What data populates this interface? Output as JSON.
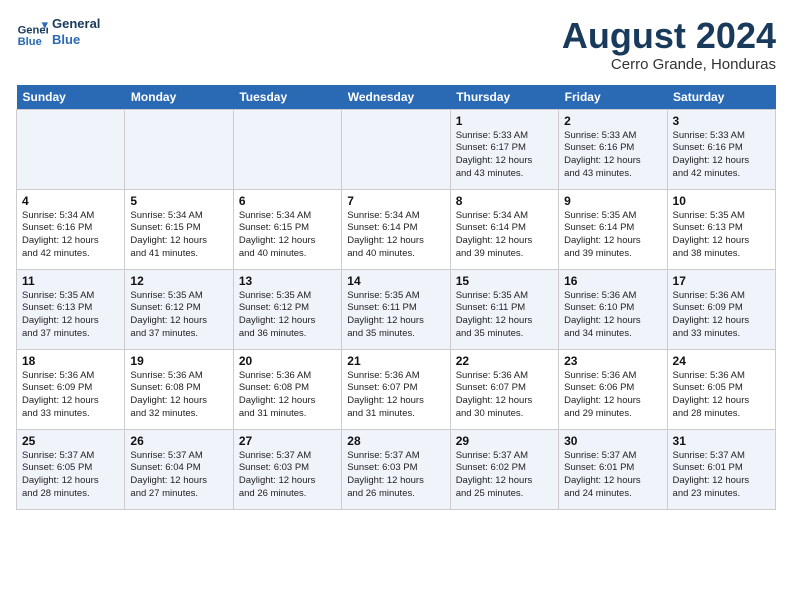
{
  "header": {
    "logo_line1": "General",
    "logo_line2": "Blue",
    "month_year": "August 2024",
    "location": "Cerro Grande, Honduras"
  },
  "days_of_week": [
    "Sunday",
    "Monday",
    "Tuesday",
    "Wednesday",
    "Thursday",
    "Friday",
    "Saturday"
  ],
  "weeks": [
    [
      {
        "num": "",
        "info": ""
      },
      {
        "num": "",
        "info": ""
      },
      {
        "num": "",
        "info": ""
      },
      {
        "num": "",
        "info": ""
      },
      {
        "num": "1",
        "info": "Sunrise: 5:33 AM\nSunset: 6:17 PM\nDaylight: 12 hours\nand 43 minutes."
      },
      {
        "num": "2",
        "info": "Sunrise: 5:33 AM\nSunset: 6:16 PM\nDaylight: 12 hours\nand 43 minutes."
      },
      {
        "num": "3",
        "info": "Sunrise: 5:33 AM\nSunset: 6:16 PM\nDaylight: 12 hours\nand 42 minutes."
      }
    ],
    [
      {
        "num": "4",
        "info": "Sunrise: 5:34 AM\nSunset: 6:16 PM\nDaylight: 12 hours\nand 42 minutes."
      },
      {
        "num": "5",
        "info": "Sunrise: 5:34 AM\nSunset: 6:15 PM\nDaylight: 12 hours\nand 41 minutes."
      },
      {
        "num": "6",
        "info": "Sunrise: 5:34 AM\nSunset: 6:15 PM\nDaylight: 12 hours\nand 40 minutes."
      },
      {
        "num": "7",
        "info": "Sunrise: 5:34 AM\nSunset: 6:14 PM\nDaylight: 12 hours\nand 40 minutes."
      },
      {
        "num": "8",
        "info": "Sunrise: 5:34 AM\nSunset: 6:14 PM\nDaylight: 12 hours\nand 39 minutes."
      },
      {
        "num": "9",
        "info": "Sunrise: 5:35 AM\nSunset: 6:14 PM\nDaylight: 12 hours\nand 39 minutes."
      },
      {
        "num": "10",
        "info": "Sunrise: 5:35 AM\nSunset: 6:13 PM\nDaylight: 12 hours\nand 38 minutes."
      }
    ],
    [
      {
        "num": "11",
        "info": "Sunrise: 5:35 AM\nSunset: 6:13 PM\nDaylight: 12 hours\nand 37 minutes."
      },
      {
        "num": "12",
        "info": "Sunrise: 5:35 AM\nSunset: 6:12 PM\nDaylight: 12 hours\nand 37 minutes."
      },
      {
        "num": "13",
        "info": "Sunrise: 5:35 AM\nSunset: 6:12 PM\nDaylight: 12 hours\nand 36 minutes."
      },
      {
        "num": "14",
        "info": "Sunrise: 5:35 AM\nSunset: 6:11 PM\nDaylight: 12 hours\nand 35 minutes."
      },
      {
        "num": "15",
        "info": "Sunrise: 5:35 AM\nSunset: 6:11 PM\nDaylight: 12 hours\nand 35 minutes."
      },
      {
        "num": "16",
        "info": "Sunrise: 5:36 AM\nSunset: 6:10 PM\nDaylight: 12 hours\nand 34 minutes."
      },
      {
        "num": "17",
        "info": "Sunrise: 5:36 AM\nSunset: 6:09 PM\nDaylight: 12 hours\nand 33 minutes."
      }
    ],
    [
      {
        "num": "18",
        "info": "Sunrise: 5:36 AM\nSunset: 6:09 PM\nDaylight: 12 hours\nand 33 minutes."
      },
      {
        "num": "19",
        "info": "Sunrise: 5:36 AM\nSunset: 6:08 PM\nDaylight: 12 hours\nand 32 minutes."
      },
      {
        "num": "20",
        "info": "Sunrise: 5:36 AM\nSunset: 6:08 PM\nDaylight: 12 hours\nand 31 minutes."
      },
      {
        "num": "21",
        "info": "Sunrise: 5:36 AM\nSunset: 6:07 PM\nDaylight: 12 hours\nand 31 minutes."
      },
      {
        "num": "22",
        "info": "Sunrise: 5:36 AM\nSunset: 6:07 PM\nDaylight: 12 hours\nand 30 minutes."
      },
      {
        "num": "23",
        "info": "Sunrise: 5:36 AM\nSunset: 6:06 PM\nDaylight: 12 hours\nand 29 minutes."
      },
      {
        "num": "24",
        "info": "Sunrise: 5:36 AM\nSunset: 6:05 PM\nDaylight: 12 hours\nand 28 minutes."
      }
    ],
    [
      {
        "num": "25",
        "info": "Sunrise: 5:37 AM\nSunset: 6:05 PM\nDaylight: 12 hours\nand 28 minutes."
      },
      {
        "num": "26",
        "info": "Sunrise: 5:37 AM\nSunset: 6:04 PM\nDaylight: 12 hours\nand 27 minutes."
      },
      {
        "num": "27",
        "info": "Sunrise: 5:37 AM\nSunset: 6:03 PM\nDaylight: 12 hours\nand 26 minutes."
      },
      {
        "num": "28",
        "info": "Sunrise: 5:37 AM\nSunset: 6:03 PM\nDaylight: 12 hours\nand 26 minutes."
      },
      {
        "num": "29",
        "info": "Sunrise: 5:37 AM\nSunset: 6:02 PM\nDaylight: 12 hours\nand 25 minutes."
      },
      {
        "num": "30",
        "info": "Sunrise: 5:37 AM\nSunset: 6:01 PM\nDaylight: 12 hours\nand 24 minutes."
      },
      {
        "num": "31",
        "info": "Sunrise: 5:37 AM\nSunset: 6:01 PM\nDaylight: 12 hours\nand 23 minutes."
      }
    ]
  ]
}
